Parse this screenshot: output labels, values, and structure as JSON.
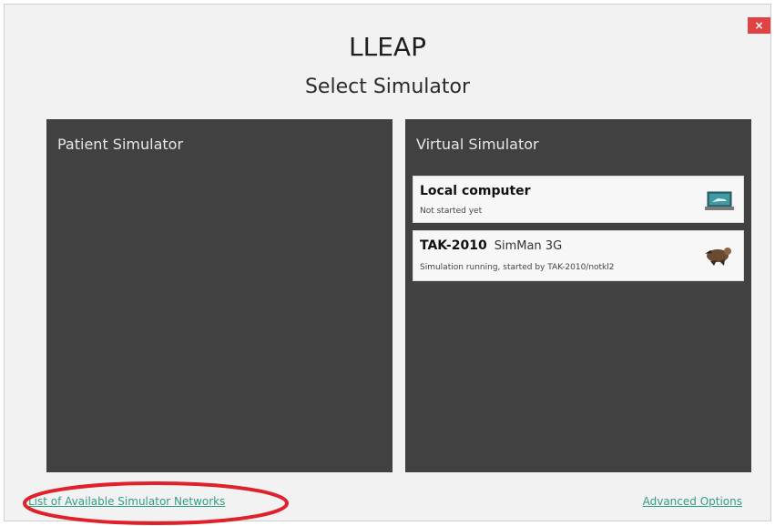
{
  "window": {
    "app_title": "LLEAP",
    "page_title": "Select Simulator",
    "close_label": "×"
  },
  "patient_panel": {
    "title": "Patient Simulator"
  },
  "virtual_panel": {
    "title": "Virtual Simulator",
    "simulators": [
      {
        "name": "Local computer",
        "model": "",
        "status": "Not started yet",
        "icon": "laptop-icon"
      },
      {
        "name": "TAK-2010",
        "model": "SimMan 3G",
        "status": "Simulation running, started by TAK-2010/notkl2",
        "icon": "mannequin-icon"
      }
    ]
  },
  "footer": {
    "networks_link": "List of Available Simulator Networks",
    "advanced_link": "Advanced Options"
  },
  "colors": {
    "panel_bg": "#404140",
    "link": "#2e9e86",
    "close_bg": "#e04343",
    "annotation": "#e0202a"
  }
}
